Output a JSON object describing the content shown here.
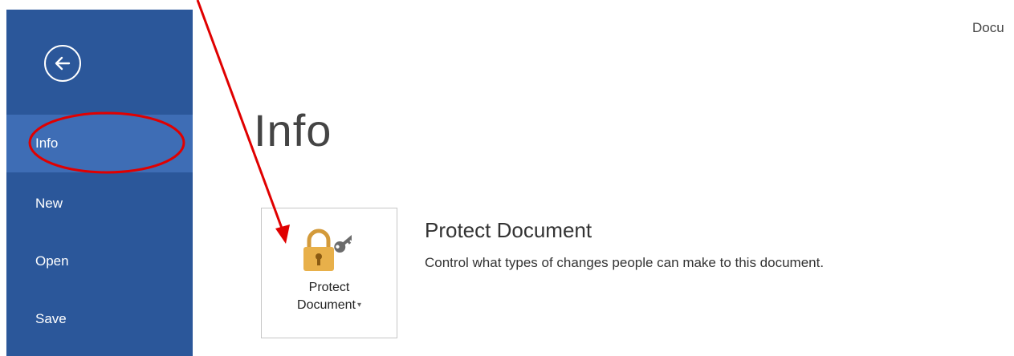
{
  "window": {
    "doc_title": "Docu"
  },
  "sidebar": {
    "items": [
      {
        "label": "Info",
        "active": true
      },
      {
        "label": "New"
      },
      {
        "label": "Open"
      },
      {
        "label": "Save"
      }
    ]
  },
  "main": {
    "page_title": "Info",
    "protect": {
      "tile_line1": "Protect",
      "tile_line2": "Document",
      "heading": "Protect Document",
      "description": "Control what types of changes people can make to this document."
    }
  },
  "colors": {
    "sidebar": "#2b579a",
    "sidebar_active": "#3e6db5",
    "annotation": "#e00000",
    "lock": "#e8b04a"
  },
  "icons": [
    "back-arrow-icon",
    "lock-key-icon",
    "dropdown-caret-icon"
  ]
}
